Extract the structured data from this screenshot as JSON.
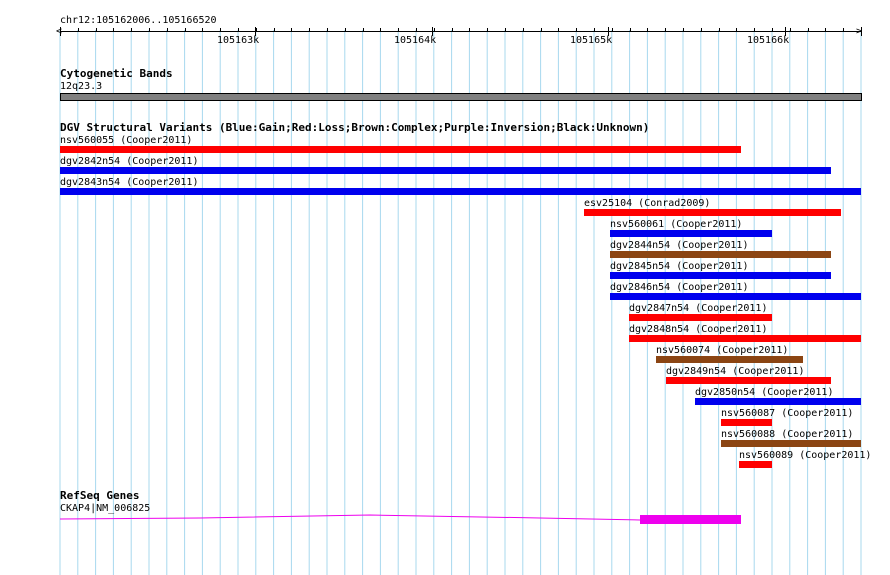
{
  "locus": "chr12:105162006..105166520",
  "ruler": {
    "ticks": [
      {
        "label": "105163k"
      },
      {
        "label": "105164k"
      },
      {
        "label": "105165k"
      },
      {
        "label": "105166k"
      }
    ]
  },
  "cytoband": {
    "title": "Cytogenetic Bands",
    "band": "12q23.3",
    "color": "#808080"
  },
  "dgv": {
    "title": "DGV Structural Variants (Blue:Gain;Red:Loss;Brown:Complex;Purple:Inversion;Black:Unknown)",
    "colors": {
      "red": "#ff0000",
      "blue": "#0000ee",
      "brown": "#8b4513"
    },
    "variants": [
      {
        "label": "nsv560055 (Cooper2011)",
        "type": "loss"
      },
      {
        "label": "dgv2842n54 (Cooper2011)",
        "type": "gain"
      },
      {
        "label": "dgv2843n54 (Cooper2011)",
        "type": "gain"
      },
      {
        "label": "esv25104 (Conrad2009)",
        "type": "loss"
      },
      {
        "label": "nsv560061 (Cooper2011)",
        "type": "gain"
      },
      {
        "label": "dgv2844n54 (Cooper2011)",
        "type": "complex"
      },
      {
        "label": "dgv2845n54 (Cooper2011)",
        "type": "gain"
      },
      {
        "label": "dgv2846n54 (Cooper2011)",
        "type": "gain"
      },
      {
        "label": "dgv2847n54 (Cooper2011)",
        "type": "loss"
      },
      {
        "label": "dgv2848n54 (Cooper2011)",
        "type": "loss"
      },
      {
        "label": "nsv560074 (Cooper2011)",
        "type": "complex"
      },
      {
        "label": "dgv2849n54 (Cooper2011)",
        "type": "loss"
      },
      {
        "label": "dgv2850n54 (Cooper2011)",
        "type": "gain"
      },
      {
        "label": "nsv560087 (Cooper2011)",
        "type": "loss"
      },
      {
        "label": "nsv560088 (Cooper2011)",
        "type": "complex"
      },
      {
        "label": "nsv560089 (Cooper2011)",
        "type": "loss"
      }
    ]
  },
  "refseq": {
    "title": "RefSeq Genes",
    "gene": "CKAP4|NM_006825",
    "color": "#ee00ee"
  }
}
